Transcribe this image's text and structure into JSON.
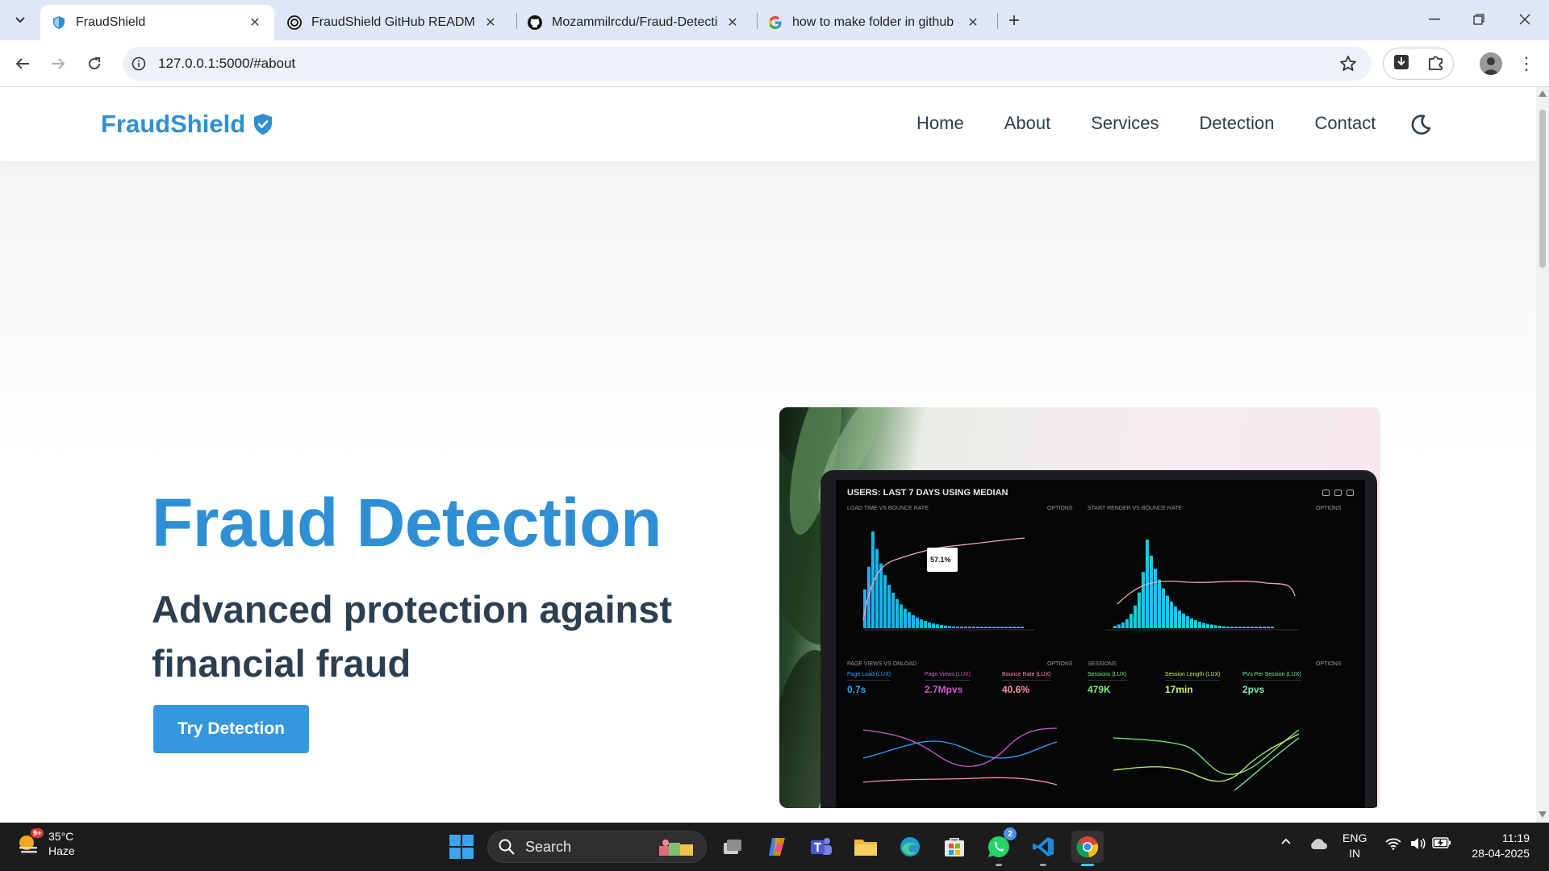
{
  "browser": {
    "tabs": [
      {
        "title": "FraudShield",
        "active": true
      },
      {
        "title": "FraudShield GitHub README",
        "active": false
      },
      {
        "title": "Mozammilrcdu/Fraud-Detection",
        "active": false
      },
      {
        "title": "how to make folder in github - ",
        "active": false
      }
    ],
    "url": "127.0.0.1:5000/#about"
  },
  "site": {
    "brand": "FraudShield",
    "nav": [
      "Home",
      "About",
      "Services",
      "Detection",
      "Contact"
    ],
    "hero": {
      "title": "Fraud Detection",
      "subtitle": "Advanced protection against financial fraud",
      "button": "Try Detection"
    }
  },
  "dashboard": {
    "header": "USERS: LAST 7 DAYS USING MEDIAN",
    "panel1_title": "LOAD TIME VS BOUNCE RATE",
    "panel2_title": "START RENDER VS BOUNCE RATE",
    "panel3_title": "PAGE VIEWS VS ONLOAD",
    "panel4_title": "SESSIONS",
    "options": "OPTIONS",
    "tooltip_value": "57.1%",
    "kpis_left": [
      {
        "label": "Page Load (LUX)",
        "value": "0.7s",
        "color": "#2aa8ff"
      },
      {
        "label": "Page Views (LUX)",
        "value": "2.7Mpvs",
        "color": "#d05bd0"
      },
      {
        "label": "Bounce Rate (LUX)",
        "value": "40.6%",
        "color": "#ff8fa8"
      }
    ],
    "kpis_right": [
      {
        "label": "Sessions (LUX)",
        "value": "479K",
        "color": "#7cf07c"
      },
      {
        "label": "Session Length (LUX)",
        "value": "17min",
        "color": "#c9f26a"
      },
      {
        "label": "PVs Per Session (LUX)",
        "value": "2pvs",
        "color": "#7cf0a8"
      }
    ]
  },
  "taskbar": {
    "weather_temp": "35°C",
    "weather_desc": "Haze",
    "weather_badge": "9+",
    "search_label": "Search",
    "whatsapp_badge": "2",
    "lang_line1": "ENG",
    "lang_line2": "IN",
    "time": "11:19",
    "date": "28-04-2025"
  },
  "colors": {
    "brand": "#2e8fd4",
    "heading": "#2c3e50",
    "button": "#3597de"
  }
}
